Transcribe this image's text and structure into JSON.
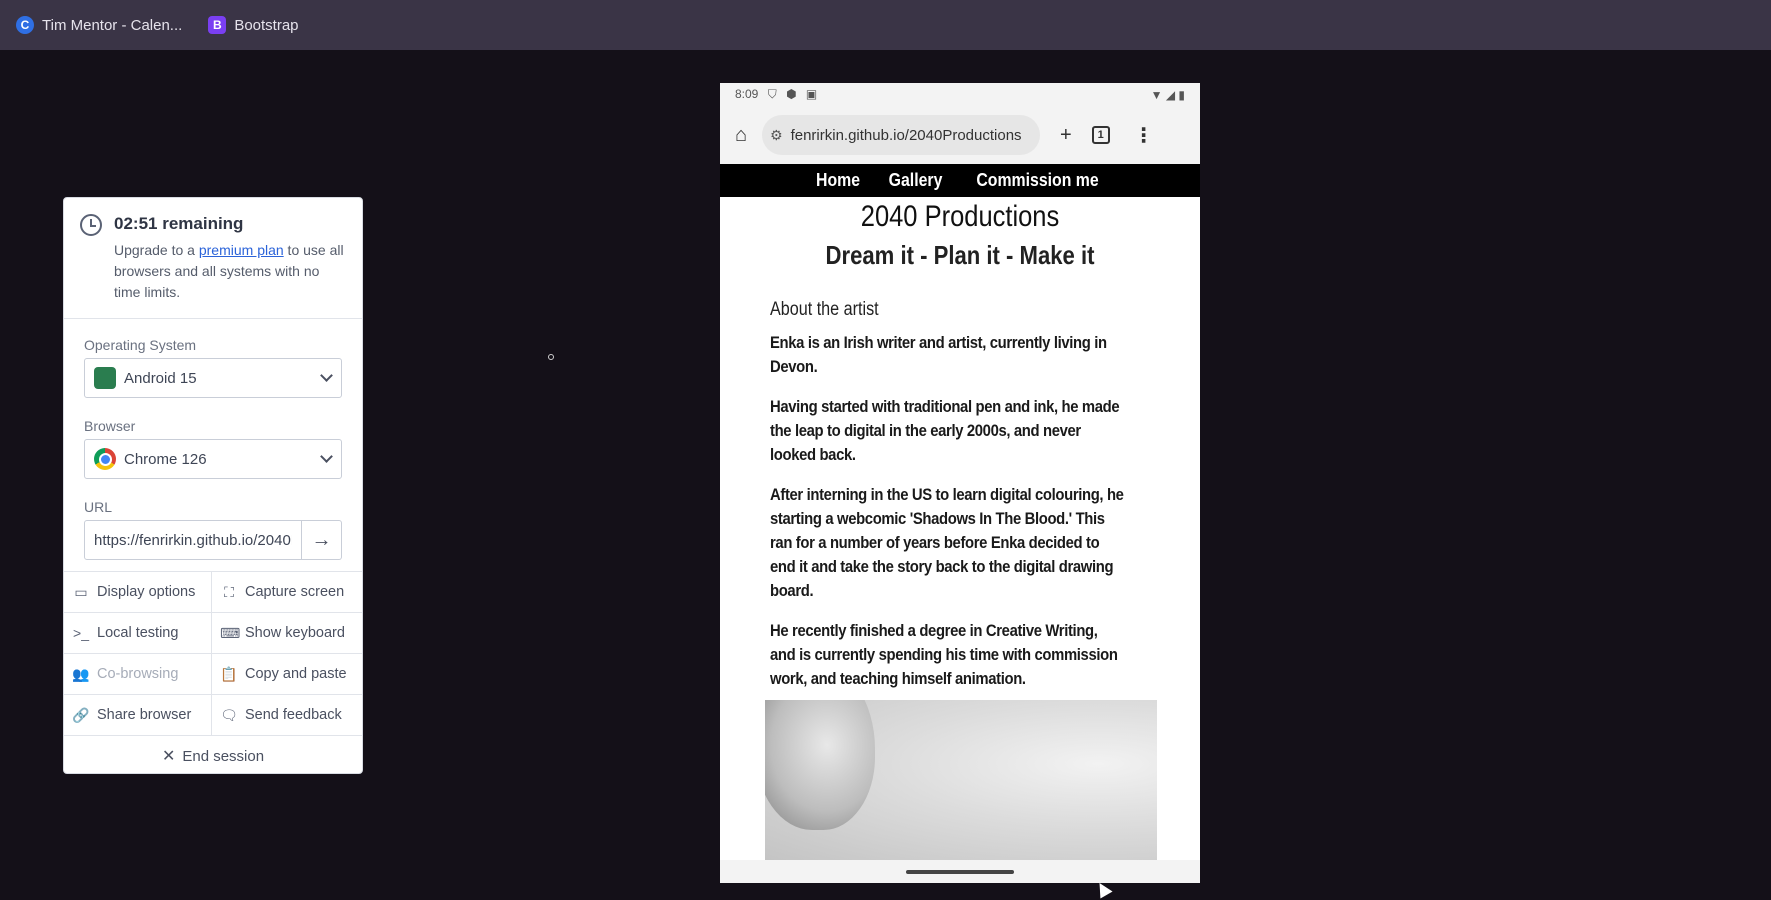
{
  "bookmarks": [
    {
      "label": "Tim Mentor - Calen...",
      "icon": "calendar-icon",
      "color": "#2f6fe4"
    },
    {
      "label": "Bootstrap",
      "icon": "bootstrap-icon",
      "color": "#7a3ff2"
    }
  ],
  "panel": {
    "timer": {
      "remaining": "02:51 remaining",
      "text_before": "Upgrade to a ",
      "link": "premium plan",
      "text_after": " to use all browsers and all systems with no time limits."
    },
    "os": {
      "label": "Operating System",
      "value": "Android 15"
    },
    "browser": {
      "label": "Browser",
      "value": "Chrome 126"
    },
    "url": {
      "label": "URL",
      "value": "https://fenrirkin.github.io/2040Productions"
    },
    "actions": [
      {
        "label": "Display options",
        "icon": "monitor-icon",
        "glyph": "▭",
        "enabled": true
      },
      {
        "label": "Capture screen",
        "icon": "capture-icon",
        "glyph": "⛶",
        "enabled": true
      },
      {
        "label": "Local testing",
        "icon": "terminal-icon",
        "glyph": ">_",
        "enabled": true
      },
      {
        "label": "Show keyboard",
        "icon": "keyboard-icon",
        "glyph": "⌨",
        "enabled": true
      },
      {
        "label": "Co-browsing",
        "icon": "users-icon",
        "glyph": "👥",
        "enabled": false
      },
      {
        "label": "Copy and paste",
        "icon": "clipboard-icon",
        "glyph": "📋",
        "enabled": true
      },
      {
        "label": "Share browser",
        "icon": "link-icon",
        "glyph": "🔗",
        "enabled": true
      },
      {
        "label": "Send feedback",
        "icon": "message-icon",
        "glyph": "🗨",
        "enabled": true
      }
    ],
    "end_session": "End session"
  },
  "phone": {
    "status": {
      "time": "8:09"
    },
    "address": "fenrirkin.github.io/2040Productions",
    "tab_count": "1",
    "nav": [
      "Home",
      "Gallery",
      "Commission me"
    ],
    "title": "2040 Productions",
    "subtitle": "Dream it - Plan it - Make it",
    "section_title": "About the artist",
    "paragraphs": [
      "Enka is an Irish writer and artist, currently living in Devon.",
      "Having started with traditional pen and ink, he made the leap to digital in the early 2000s, and never looked back.",
      "After interning in the US to learn digital colouring, he starting a webcomic 'Shadows In The Blood.' This ran for a number of years before Enka decided to end it and take the story back to the digital drawing board.",
      "He recently finished a degree in Creative Writing, and is currently spending his time with commission work, and teaching himself animation."
    ]
  }
}
